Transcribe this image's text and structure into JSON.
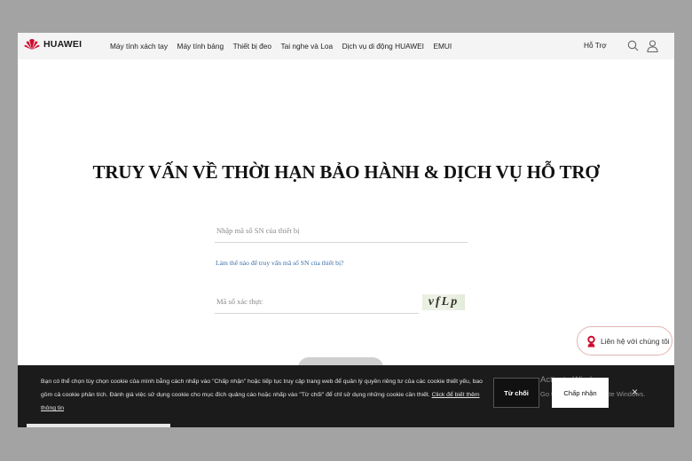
{
  "brand": {
    "name": "HUAWEI",
    "logo_color": "#cf0a2c"
  },
  "nav": {
    "items": [
      "Máy tính xách tay",
      "Máy tính bảng",
      "Thiết bị đeo",
      "Tai nghe và Loa",
      "Dịch vụ di động HUAWEI",
      "EMUI"
    ],
    "support": "Hỗ Trợ",
    "icons": [
      "search-icon",
      "user-icon"
    ]
  },
  "main": {
    "title": "TRUY VẤN VỀ THỜI HẠN BẢO HÀNH & DỊCH VỤ HỖ TRỢ",
    "sn_input": {
      "placeholder": "Nhập mã số SN của thiết bị",
      "value": ""
    },
    "help_link": "Làm thế nào để truy vấn mã số SN của thiết bị?",
    "captcha_input": {
      "placeholder": "Mã số xác thực",
      "value": ""
    },
    "captcha_text": "vfLp"
  },
  "contact": {
    "label": "Liên hệ với chúng tôi",
    "icon": "chat-person-icon"
  },
  "cookie": {
    "text": "Bạn có thể chọn tùy chọn cookie của mình bằng cách nhấp vào \"Chấp nhận\" hoặc tiếp tục truy cập trang web để quản lý quyền riêng tư của các cookie thiết yếu, bao gồm cả cookie phân tích. Đánh giá việc sử dụng cookie cho mục đích quảng cáo hoặc nhấp vào \"Từ chối\" để chỉ sử dụng những cookie cần thiết.",
    "more_link": "Click để biết thêm thông tin",
    "reject": "Từ chối",
    "accept": "Chấp nhận",
    "close": "×"
  },
  "watermark": {
    "title": "Activate Windows",
    "subtitle": "Go to Settings to activate Windows."
  }
}
